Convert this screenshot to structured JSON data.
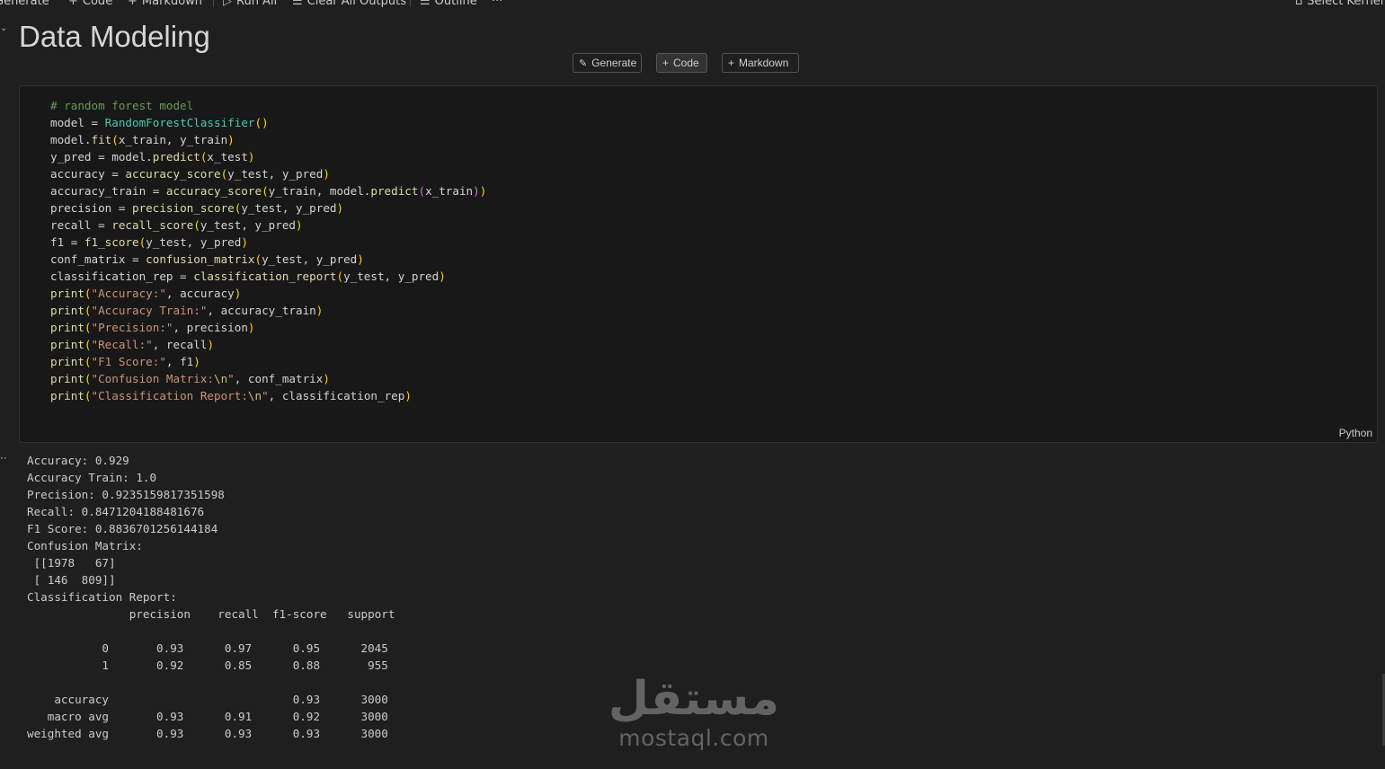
{
  "toolbar": {
    "generate": "Generate",
    "code": "Code",
    "markdown": "Markdown",
    "run_all": "Run All",
    "clear_all_outputs": "Clear All Outputs",
    "outline": "Outline",
    "more": "···",
    "select_kernel": "Select Kernel"
  },
  "heading": {
    "title": "Data Modeling"
  },
  "cell_toolbar": {
    "generate": "Generate",
    "code": "Code",
    "markdown": "Markdown"
  },
  "code_cell": {
    "language": "Python",
    "lines": [
      "# random forest model",
      "model = RandomForestClassifier()",
      "model.fit(x_train, y_train)",
      "y_pred = model.predict(x_test)",
      "accuracy = accuracy_score(y_test, y_pred)",
      "accuracy_train = accuracy_score(y_train, model.predict(x_train))",
      "precision = precision_score(y_test, y_pred)",
      "recall = recall_score(y_test, y_pred)",
      "f1 = f1_score(y_test, y_pred)",
      "conf_matrix = confusion_matrix(y_test, y_pred)",
      "classification_rep = classification_report(y_test, y_pred)",
      "print(\"Accuracy:\", accuracy)",
      "print(\"Accuracy Train:\", accuracy_train)",
      "print(\"Precision:\", precision)",
      "print(\"Recall:\", recall)",
      "print(\"F1 Score:\", f1)",
      "print(\"Confusion Matrix:\\n\", conf_matrix)",
      "print(\"Classification Report:\\n\", classification_rep)"
    ]
  },
  "output": {
    "text": "Accuracy: 0.929\nAccuracy Train: 1.0\nPrecision: 0.9235159817351598\nRecall: 0.8471204188481676\nF1 Score: 0.8836701256144184\nConfusion Matrix:\n [[1978   67]\n [ 146  809]]\nClassification Report:\n               precision    recall  f1-score   support\n\n           0       0.93      0.97      0.95      2045\n           1       0.92      0.85      0.88       955\n\n    accuracy                           0.93      3000\n   macro avg       0.93      0.91      0.92      3000\nweighted avg       0.93      0.93      0.93      3000"
  },
  "watermark": {
    "arabic": "مستقل",
    "latin": "mostaql.com"
  },
  "colors": {
    "background": "#1f1f1f",
    "cell_bg": "#181818",
    "comment": "#6a9955",
    "class": "#4ec9b0",
    "function": "#dcdcaa",
    "string": "#ce9178"
  }
}
